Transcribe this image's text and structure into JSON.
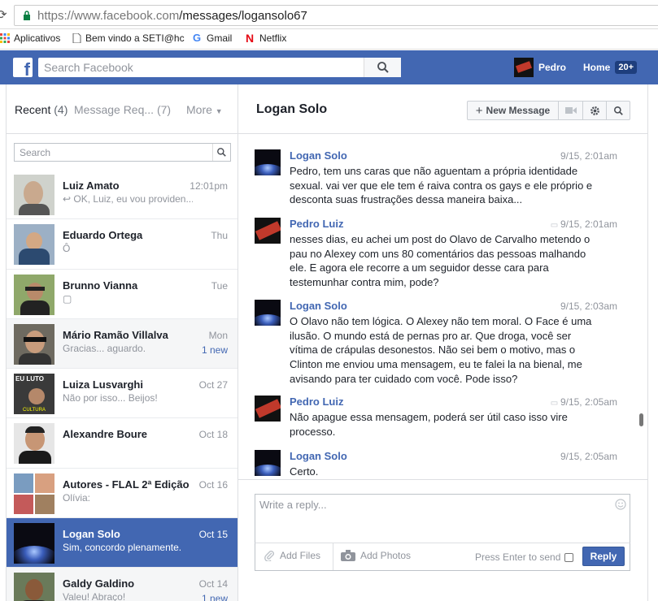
{
  "browser": {
    "url_prefix": "https://www.facebook.com",
    "url_path": "/messages/logansolo67",
    "bookmarks": [
      {
        "label": "Aplicativos"
      },
      {
        "label": "Bem vindo a SETI@hc"
      },
      {
        "label": "Gmail"
      },
      {
        "label": "Netflix"
      }
    ]
  },
  "topbar": {
    "search_placeholder": "Search Facebook",
    "user_name": "Pedro",
    "home_label": "Home",
    "home_badge": "20+"
  },
  "left": {
    "recent_label": "Recent",
    "recent_count": "(4)",
    "requests_label": "Message Req...",
    "requests_count": "(7)",
    "more_label": "More",
    "search_placeholder": "Search",
    "conversations": [
      {
        "name": "Luiz Amato",
        "snippet": "↩ OK, Luiz, eu vou providen...",
        "time": "12:01pm",
        "new": ""
      },
      {
        "name": "Eduardo Ortega",
        "snippet": "Ô",
        "time": "Thu",
        "new": ""
      },
      {
        "name": "Brunno Vianna",
        "snippet": "▢",
        "time": "Tue",
        "new": ""
      },
      {
        "name": "Mário Ramão Villalva",
        "snippet": "Gracias... aguardo.",
        "time": "Mon",
        "new": "1 new"
      },
      {
        "name": "Luiza Lusvarghi",
        "snippet": "Não por isso... Beijos!",
        "time": "Oct 27",
        "new": ""
      },
      {
        "name": "Alexandre Boure",
        "snippet": "",
        "time": "Oct 18",
        "new": ""
      },
      {
        "name": "Autores - FLAL 2ª Edição",
        "snippet": "Olívia:",
        "time": "Oct 16",
        "new": ""
      },
      {
        "name": "Logan Solo",
        "snippet": "Sim, concordo plenamente.",
        "time": "Oct 15",
        "new": ""
      },
      {
        "name": "Galdy Galdino",
        "snippet": "Valeu! Abraço!",
        "time": "Oct 14",
        "new": "1 new"
      }
    ]
  },
  "thread": {
    "title": "Logan Solo",
    "new_message_label": "New Message",
    "messages": [
      {
        "who": "Logan Solo",
        "when": "9/15, 2:01am",
        "text": "Pedro, tem uns caras que não aguentam a própria identidade sexual. vai ver que ele tem é raiva contra os gays e ele próprio e desconta suas frustrações dessa maneira baixa..."
      },
      {
        "who": "Pedro Luiz",
        "when": "9/15, 2:01am",
        "text": "nesses dias, eu achei um post do Olavo de Carvalho metendo o pau no Alexey com uns 80 comentários das pessoas malhando ele. E agora ele recorre a um seguidor desse cara para testemunhar contra mim, pode?"
      },
      {
        "who": "Logan Solo",
        "when": "9/15, 2:03am",
        "text": "O Olavo não tem lógica. O Alexey não tem moral. O Face é uma ilusão. O mundo está de pernas pro ar. Que droga, você ser vítima de  crápulas desonestos. Não sei bem o motivo, mas o Clinton me enviou uma mensagem, eu te falei la na bienal, me avisando para ter cuidado com você. Pode isso?"
      },
      {
        "who": "Pedro Luiz",
        "when": "9/15, 2:05am",
        "text": "Não apague essa mensagem, poderá ser útil caso isso vire processo."
      },
      {
        "who": "Logan Solo",
        "when": "9/15, 2:05am",
        "text": "Certo."
      }
    ]
  },
  "reply": {
    "placeholder": "Write a reply...",
    "add_files": "Add Files",
    "add_photos": "Add Photos",
    "press_enter": "Press Enter to send",
    "send_label": "Reply"
  }
}
